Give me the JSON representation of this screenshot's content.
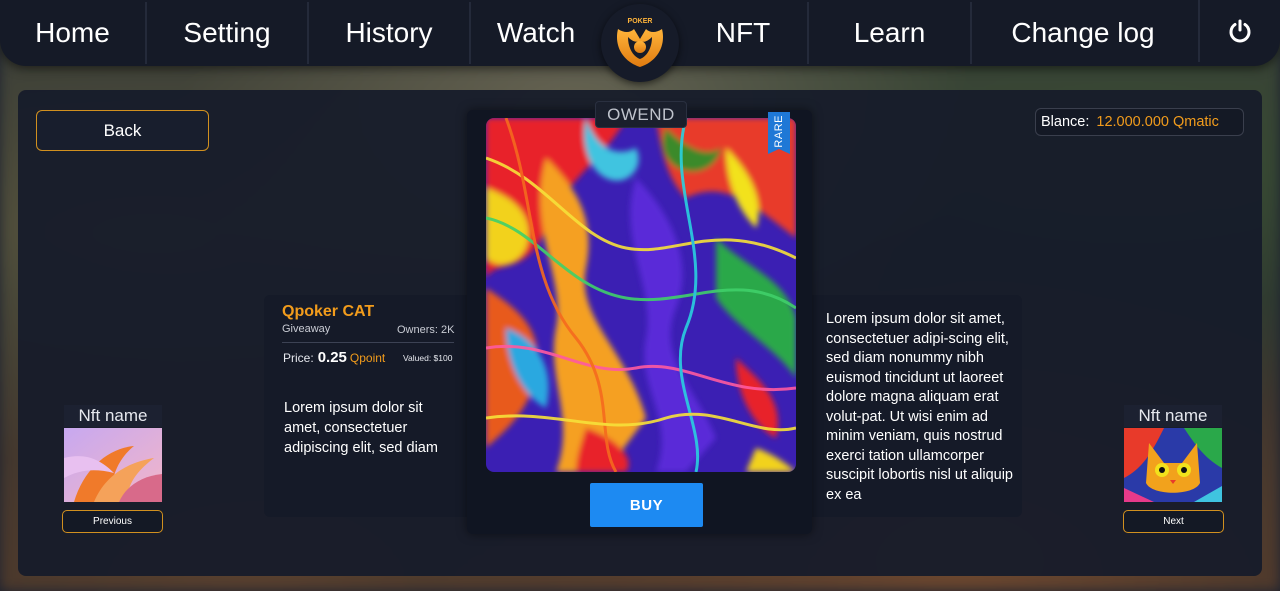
{
  "nav": {
    "items": [
      {
        "label": "Home",
        "width": 147
      },
      {
        "label": "Setting",
        "width": 162
      },
      {
        "label": "History",
        "width": 162
      },
      {
        "label": "Watch",
        "width": 130
      }
    ],
    "items_right": [
      {
        "label": "NFT",
        "width": 130
      },
      {
        "label": "Learn",
        "width": 163
      },
      {
        "label": "Change log",
        "width": 222
      }
    ],
    "logo_text": "POKER",
    "power_icon": "power-icon"
  },
  "back_label": "Back",
  "balance": {
    "label": "Blance:",
    "value": "12.000.000 Qmatic"
  },
  "card": {
    "owned_label": "OWEND",
    "rare_label": "RARE",
    "buy_label": "BUY"
  },
  "info": {
    "title": "Qpoker CAT",
    "type": "Giveaway",
    "owners": "Owners: 2K",
    "price_label": "Price:",
    "price_value": "0.25",
    "price_unit": "Qpoint",
    "valued": "Valued: $100",
    "description": "Lorem ipsum dolor sit amet, consectetuer adipiscing elit, sed diam"
  },
  "description_right": "Lorem ipsum dolor sit amet, consectetuer adipi-scing elit, sed diam nonummy nibh euismod tincidunt ut laoreet dolore magna aliquam erat volut-pat. Ut wisi enim ad minim veniam, quis nostrud exerci tation ullamcorper suscipit lobortis nisl ut aliquip ex ea",
  "prev": {
    "title": "Nft name",
    "button": "Previous"
  },
  "next": {
    "title": "Nft name",
    "button": "Next"
  },
  "colors": {
    "accent": "#f29c1c",
    "buy": "#1d8af2",
    "nav_bg": "#151a27"
  }
}
